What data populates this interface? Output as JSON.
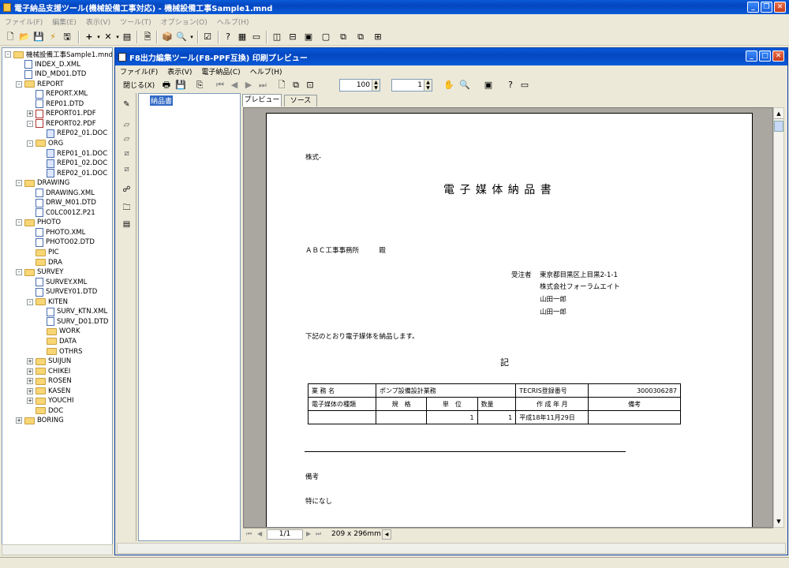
{
  "app": {
    "title": "電子納品支援ツール(機械設備工事対応) - 機械設備工事Sample1.mnd",
    "menu": [
      "ファイル(F)",
      "編集(E)",
      "表示(V)",
      "ツール(T)",
      "オプション(O)",
      "ヘルプ(H)"
    ],
    "win_min": "_",
    "win_restore": "❐",
    "win_close": "✕"
  },
  "tree": {
    "root": "機械設備工事Sample1.mnd",
    "items": [
      "INDEX_D.XML",
      "IND_MD01.DTD",
      "REPORT",
      "REPORT.XML",
      "REP01.DTD",
      "REPORT01.PDF",
      "REPORT02.PDF",
      "REP02_01.DOC",
      "ORG",
      "REP01_01.DOC",
      "REP01_02.DOC",
      "REP02_01.DOC",
      "DRAWING",
      "DRAWING.XML",
      "DRW_M01.DTD",
      "C0LC001Z.P21",
      "PHOTO",
      "PHOTO.XML",
      "PHOTO02.DTD",
      "PIC",
      "DRA",
      "SURVEY",
      "SURVEY.XML",
      "SURVEY01.DTD",
      "KITEN",
      "SURV_KTN.XML",
      "SURV_D01.DTD",
      "WORK",
      "DATA",
      "OTHRS",
      "SUIJUN",
      "CHIKEI",
      "ROSEN",
      "KASEN",
      "YOUCHI",
      "DOC",
      "BORING"
    ]
  },
  "child": {
    "title": "F8出力編集ツール(F8-PPF互換) 印刷プレビュー",
    "menu": [
      "ファイル(F)",
      "表示(V)",
      "電子納品(C)",
      "ヘルプ(H)"
    ],
    "close_label": "閉じる(X)",
    "zoom": "100",
    "page_input": "1",
    "doc_list_item": "納品書",
    "tabs": [
      "プレビュー",
      "ソース"
    ],
    "page_indicator": "1/1",
    "page_size": "209 x 296mm"
  },
  "document": {
    "header": "株式-",
    "title": "電 子 媒 体 納 品 書",
    "addressee": "ＡＢＣ工事事務所　　　殿",
    "contractor_label": "受注者",
    "address": "東京都目黒区上目黒2-1-1",
    "company": "株式会社フォーラムエイト",
    "person1": "山田一郎",
    "person2": "山田一郎",
    "intro": "下記のとおり電子媒体を納品します。",
    "ki": "記",
    "table": {
      "row1": [
        "業 務 名",
        "ポンプ設備設計業務",
        "TECRIS登録番号",
        "3000306287"
      ],
      "headers": [
        "電子媒体の種類",
        "規　格",
        "単　位",
        "数量",
        "作 成 年 月",
        "備考"
      ],
      "values": [
        "",
        "",
        "1",
        "1",
        "平成18年11月29日",
        ""
      ]
    },
    "remarks_label": "備考",
    "remarks_value": "特になし"
  }
}
